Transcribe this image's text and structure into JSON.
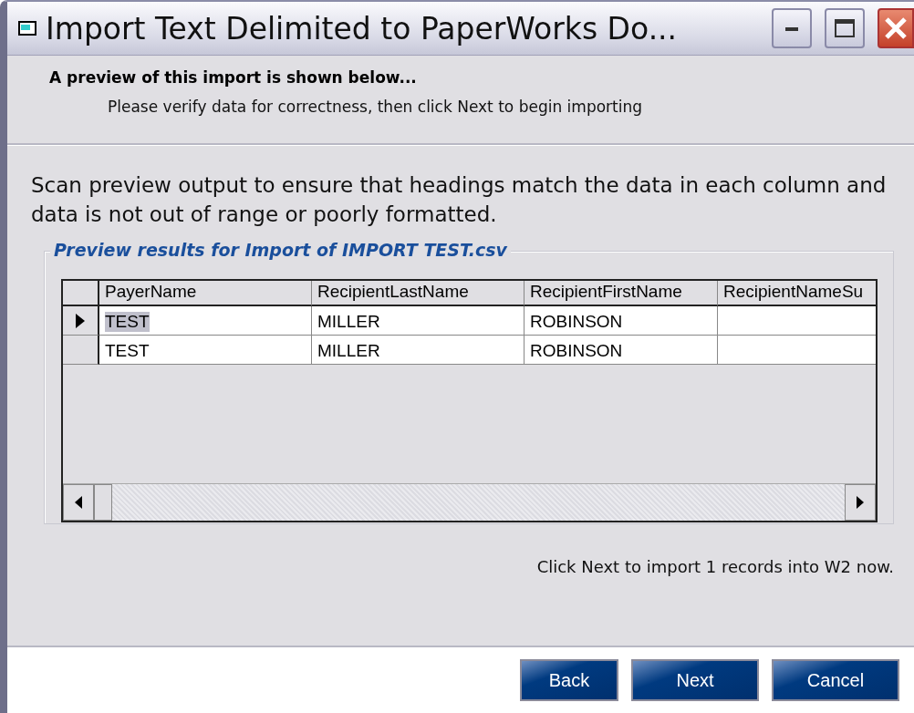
{
  "window": {
    "title": "Import Text Delimited to PaperWorks Do..."
  },
  "header": {
    "heading": "A preview of this import is shown below...",
    "subheading": "Please verify data for correctness, then click Next to begin importing"
  },
  "instructions": "Scan preview output to ensure that headings match the data in each column and data is not out of range or poorly formatted.",
  "preview": {
    "title": "Preview results for Import of IMPORT TEST.csv",
    "table": {
      "columns": [
        "PayerName",
        "RecipientLastName",
        "RecipientFirstName",
        "RecipientNameSu"
      ],
      "rows": [
        {
          "selected": true,
          "cells": [
            "TEST",
            "MILLER",
            "ROBINSON"
          ]
        },
        {
          "selected": false,
          "cells": [
            "TEST",
            "MILLER",
            "ROBINSON"
          ]
        }
      ]
    }
  },
  "summary": "Click Next to import 1 records into W2 now.",
  "buttons": [
    "Back",
    "Next",
    "Cancel"
  ]
}
